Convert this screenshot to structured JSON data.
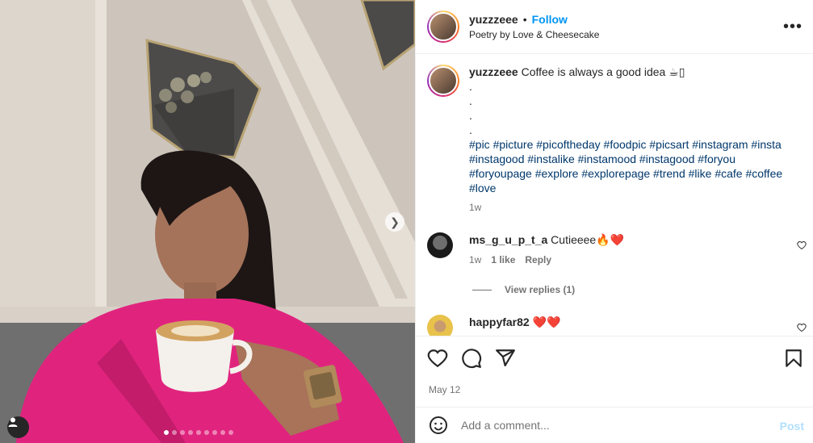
{
  "post": {
    "username": "yuzzzeee",
    "follow_label": "Follow",
    "separator": "•",
    "subtitle": "Poetry by Love & Cheesecake",
    "more_label": "•••"
  },
  "caption": {
    "username": "yuzzzeee",
    "text": "Coffee is always a good idea",
    "emoji": "☕▯",
    "dots": [
      ".",
      ".",
      ".",
      "."
    ],
    "hashtags": "#pic #picture #picoftheday #foodpic #picsart #instagram #insta #instagood #instalike #instamood #instagood #foryou #foryoupage #explore #explorepage #trend #like #cafe #coffee #love",
    "time": "1w"
  },
  "comments": [
    {
      "username": "ms_g_u_p_t_a",
      "text": "Cutieeee🔥❤️",
      "time": "1w",
      "likes": "1 like",
      "reply_label": "Reply"
    },
    {
      "username": "happyfar82",
      "text": "❤️❤️"
    }
  ],
  "view_replies_label": "View replies (1)",
  "date": "May 12",
  "add_comment": {
    "placeholder": "Add a comment...",
    "post_label": "Post"
  },
  "carousel": {
    "slide_count": 9,
    "active_index": 0
  },
  "icons": {
    "like": "heart-icon",
    "comment": "comment-icon",
    "share": "share-icon",
    "save": "bookmark-icon",
    "emoji": "emoji-icon",
    "tag": "user-tag-icon",
    "next": "chevron-right-icon"
  },
  "colors": {
    "accent": "#0095f6",
    "hashtag": "#00376b",
    "muted": "#737373",
    "post_disabled": "#b2dffc"
  }
}
